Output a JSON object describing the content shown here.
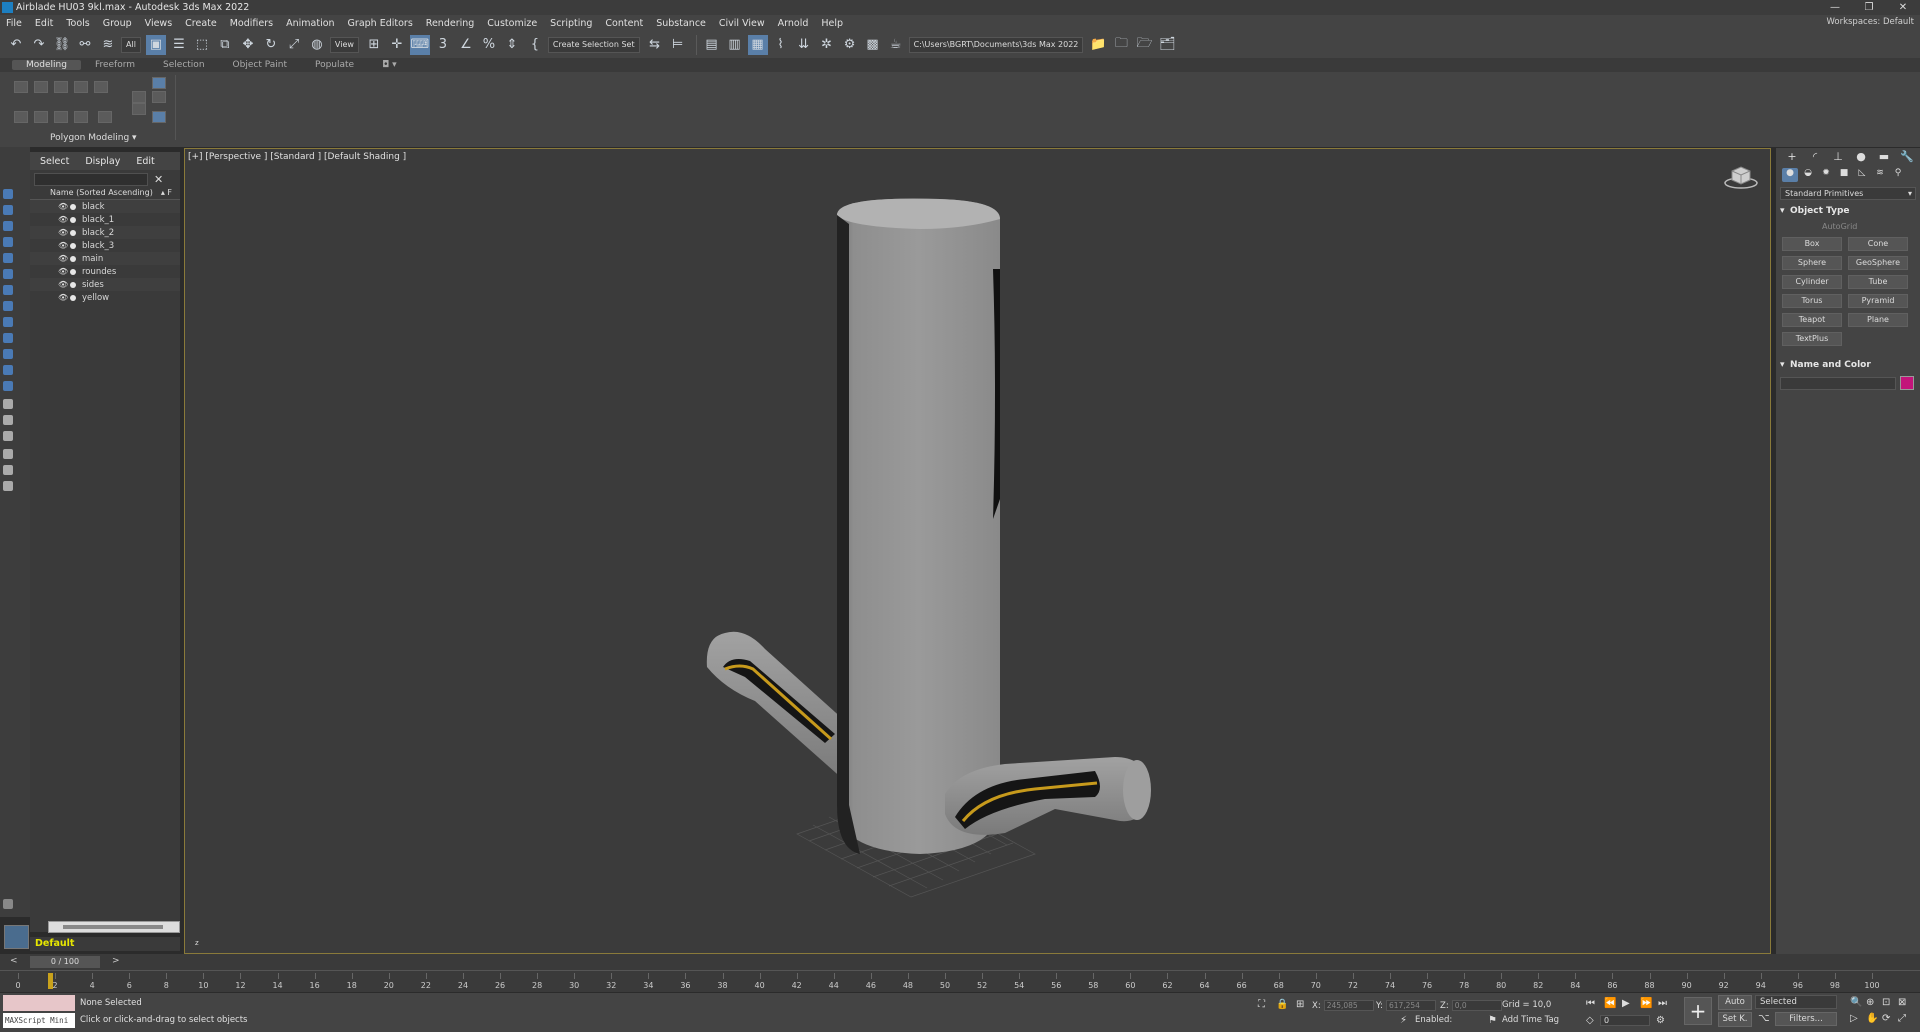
{
  "window": {
    "title": "Airblade HU03 9kl.max - Autodesk 3ds Max 2022",
    "workspaces": "Workspaces: Default",
    "min": "—",
    "max": "❐",
    "close": "✕"
  },
  "menu": [
    "File",
    "Edit",
    "Tools",
    "Group",
    "Views",
    "Create",
    "Modifiers",
    "Animation",
    "Graph Editors",
    "Rendering",
    "Customize",
    "Scripting",
    "Content",
    "Substance",
    "Civil View",
    "Arnold",
    "Help"
  ],
  "toolbar": {
    "filter": "All",
    "refcoord": "View",
    "selset": "Create Selection Set",
    "path": "C:\\Users\\BGRT\\Documents\\3ds Max 2022"
  },
  "ribbon": {
    "tabs": [
      "Modeling",
      "Freeform",
      "Selection",
      "Object Paint",
      "Populate"
    ],
    "group_label": "Polygon Modeling ▾"
  },
  "scene_explorer": {
    "tabs": [
      "Select",
      "Display",
      "Edit"
    ],
    "column": "Name (Sorted Ascending)",
    "sort_arrow": "▴ F",
    "close": "✕",
    "objects": [
      "black",
      "black_1",
      "black_2",
      "black_3",
      "main",
      "roundes",
      "sides",
      "yellow"
    ]
  },
  "layer": {
    "name": "Default"
  },
  "viewport": {
    "label": "[+] [Perspective ] [Standard ] [Default Shading ]",
    "axis": "z"
  },
  "command_panel": {
    "category": "Standard Primitives",
    "object_type": "Object Type",
    "autogrid": "AutoGrid",
    "primitives": [
      "Box",
      "Cone",
      "Sphere",
      "GeoSphere",
      "Cylinder",
      "Tube",
      "Torus",
      "Pyramid",
      "Teapot",
      "Plane",
      "TextPlus"
    ],
    "name_and_color": "Name and Color",
    "object_color": "#c3147a"
  },
  "timeline": {
    "frame": "0 / 100",
    "ticks": [
      "0",
      "2",
      "4",
      "6",
      "8",
      "10",
      "12",
      "14",
      "16",
      "18",
      "20",
      "22",
      "24",
      "26",
      "28",
      "30",
      "32",
      "34",
      "36",
      "38",
      "40",
      "42",
      "44",
      "46",
      "48",
      "50",
      "52",
      "54",
      "56",
      "58",
      "60",
      "62",
      "64",
      "66",
      "68",
      "70",
      "72",
      "74",
      "76",
      "78",
      "80",
      "82",
      "84",
      "86",
      "88",
      "90",
      "92",
      "94",
      "96",
      "98",
      "100"
    ]
  },
  "status": {
    "maxscript": "MAXScript Mini",
    "selection": "None Selected",
    "prompt": "Click or click-and-drag to select objects",
    "x_label": "X:",
    "x_val": "245,085",
    "y_label": "Y:",
    "y_val": "617,254",
    "z_label": "Z:",
    "z_val": "0,0",
    "grid": "Grid = 10,0",
    "enabled": "Enabled:",
    "add_time_tag": "Add Time Tag",
    "auto": "Auto",
    "selected": "Selected",
    "setk": "Set K.",
    "filters": "Filters...",
    "frame_field": "0"
  }
}
